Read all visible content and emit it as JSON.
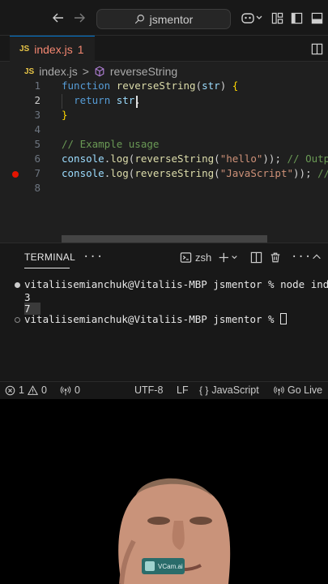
{
  "titlebar": {
    "search_text": "jsmentor",
    "icons": [
      "back-arrow-icon",
      "forward-arrow-icon",
      "search-icon",
      "copilot-icon",
      "layout-icon",
      "sidebar-icon",
      "panel-icon"
    ]
  },
  "tab": {
    "badge": "JS",
    "filename": "index.js",
    "problems": "1"
  },
  "breadcrumb": {
    "badge": "JS",
    "file": "index.js",
    "separator": ">",
    "symbol": "reverseString"
  },
  "editor": {
    "lines": [
      {
        "num": "1",
        "tokens": [
          [
            "kw",
            "function "
          ],
          [
            "fn",
            "reverseString"
          ],
          [
            "d",
            "("
          ],
          [
            "p",
            "str"
          ],
          [
            "d",
            ") "
          ],
          [
            "b",
            "{"
          ]
        ]
      },
      {
        "num": "2",
        "tokens": [
          [
            "d",
            "  "
          ],
          [
            "kw",
            "return "
          ],
          [
            "p",
            "str"
          ],
          [
            "d",
            "."
          ]
        ]
      },
      {
        "num": "3",
        "tokens": [
          [
            "b",
            "}"
          ]
        ]
      },
      {
        "num": "4",
        "tokens": []
      },
      {
        "num": "5",
        "tokens": [
          [
            "c",
            "// Example usage"
          ]
        ]
      },
      {
        "num": "6",
        "tokens": [
          [
            "p",
            "console"
          ],
          [
            "d",
            "."
          ],
          [
            "fn",
            "log"
          ],
          [
            "d",
            "("
          ],
          [
            "fn",
            "reverseString"
          ],
          [
            "d",
            "("
          ],
          [
            "s",
            "\"hello\""
          ],
          [
            "d",
            "));"
          ],
          [
            "c",
            " // Output: \"olleh\""
          ]
        ]
      },
      {
        "num": "7",
        "tokens": [
          [
            "p",
            "console"
          ],
          [
            "d",
            "."
          ],
          [
            "fn",
            "log"
          ],
          [
            "d",
            "("
          ],
          [
            "fn",
            "reverseString"
          ],
          [
            "d",
            "("
          ],
          [
            "s",
            "\"JavaScript\""
          ],
          [
            "d",
            "));"
          ],
          [
            "c",
            " // Output: \"tpircSavaJ\""
          ]
        ]
      },
      {
        "num": "8",
        "tokens": []
      }
    ],
    "current_line": "2",
    "breakpoint_line": "7"
  },
  "terminal": {
    "tab_label": "TERMINAL",
    "more": "···",
    "shell": "zsh",
    "prompt1": "vitaliisemianchuk@Vitaliis-MBP jsmentor % node index.js",
    "out1": "3",
    "out2": "7",
    "prompt2": "vitaliisemianchuk@Vitaliis-MBP jsmentor % "
  },
  "status": {
    "errors": "1",
    "warnings": "0",
    "ports": "0",
    "encoding": "UTF-8",
    "eol": "LF",
    "language": "JavaScript",
    "live": "Go Live"
  },
  "webcam": {
    "badge_text": "VCam.ai"
  },
  "colors": {
    "accent": "#0078d4",
    "breakpoint": "#e51400",
    "badge": "#2a6c6a"
  }
}
